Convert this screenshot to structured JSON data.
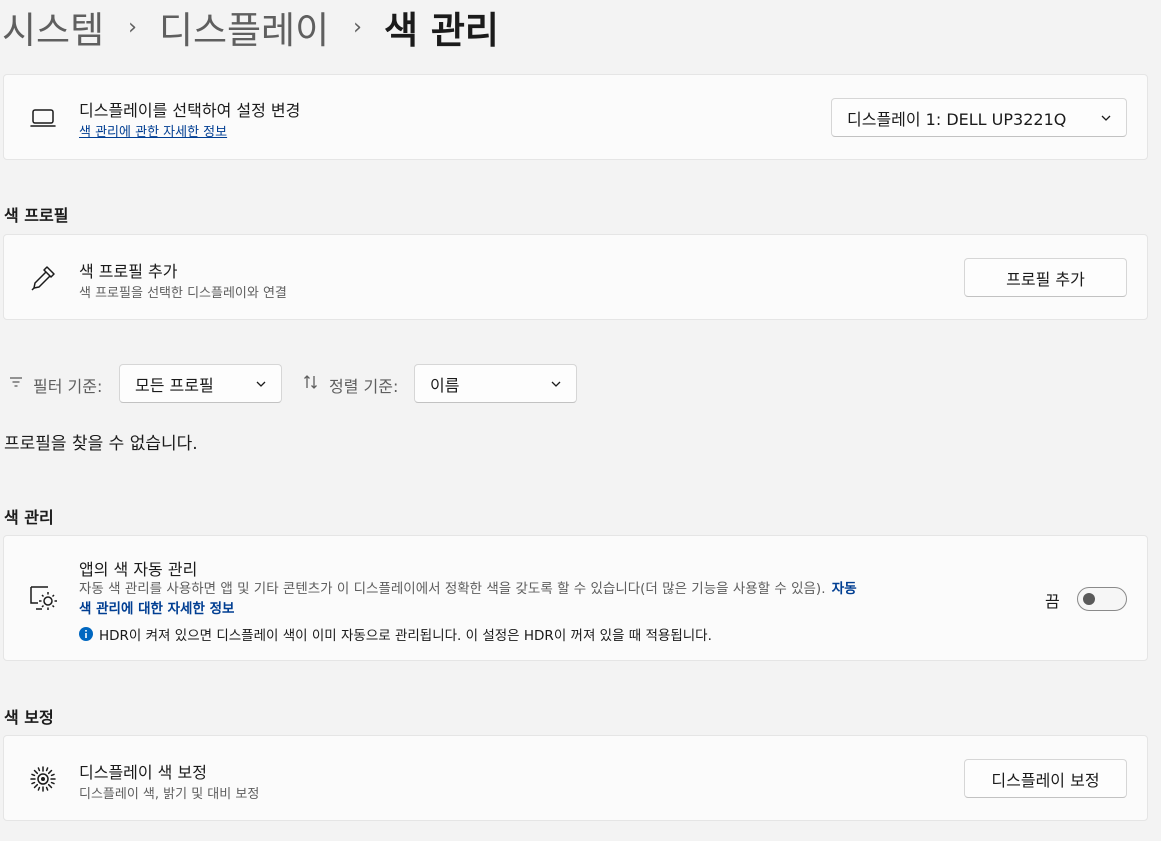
{
  "breadcrumb": {
    "items": [
      "시스템",
      "디스플레이"
    ],
    "current": "색 관리",
    "separator": "›"
  },
  "display_select": {
    "title": "디스플레이를 선택하여 설정 변경",
    "link": "색 관리에 관한 자세한 정보",
    "dropdown_value": "디스플레이 1: DELL UP3221Q",
    "icon": "laptop-icon"
  },
  "color_profiles": {
    "section_title": "색 프로필",
    "add_title": "색 프로필 추가",
    "add_sub": "색 프로필을 선택한 디스플레이와 연결",
    "add_button": "프로필 추가",
    "icon": "eyedropper-icon"
  },
  "filters": {
    "filter_label": "필터 기준:",
    "filter_value": "모든 프로필",
    "sort_label": "정렬 기준:",
    "sort_value": "이름",
    "empty_message": "프로필을 찾을 수 없습니다."
  },
  "color_management": {
    "section_title": "색 관리",
    "title": "앱의 색 자동 관리",
    "description": "자동 색 관리를 사용하면 앱 및 기타 콘텐츠가 이 디스플레이에서 정확한 색을 갖도록 할 수 있습니다(더 많은 기능을 사용할 수 있음).",
    "link_part1": "자동",
    "link_part2": "색 관리에 대한 자세한 정보",
    "info_text": "HDR이 켜져 있으면 디스플레이 색이 이미 자동으로 관리됩니다. 이 설정은 HDR이 꺼져 있을 때 적용됩니다.",
    "toggle_state_label": "끔",
    "toggle_on": false,
    "icon": "auto-color-icon"
  },
  "calibration": {
    "section_title": "색 보정",
    "title": "디스플레이 색 보정",
    "sub": "디스플레이 색, 밝기 및 대비 보정",
    "button": "디스플레이 보정",
    "icon": "calibration-icon"
  },
  "colors": {
    "accent_link": "#003e92",
    "info_blue": "#0067c0"
  }
}
